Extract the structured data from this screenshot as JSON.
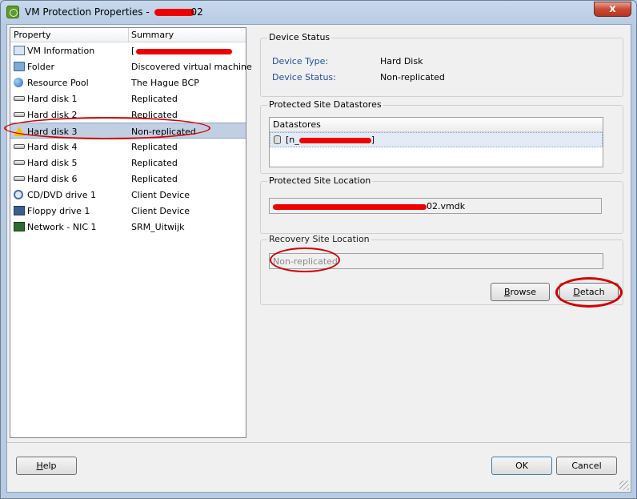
{
  "window": {
    "title_prefix": "VM Protection Properties - ",
    "title_suffix": "02",
    "close_label": "x"
  },
  "list": {
    "col_property": "Property",
    "col_summary": "Summary",
    "rows": [
      {
        "name": "VM Information",
        "summary": "[",
        "icon": "vm-info-icon"
      },
      {
        "name": "Folder",
        "summary": "Discovered virtual machine",
        "icon": "folder-icon"
      },
      {
        "name": "Resource Pool",
        "summary": "The Hague BCP",
        "icon": "resource-pool-icon"
      },
      {
        "name": "Hard disk 1",
        "summary": "Replicated",
        "icon": "hard-disk-icon"
      },
      {
        "name": "Hard disk 2",
        "summary": "Replicated",
        "icon": "hard-disk-icon"
      },
      {
        "name": "Hard disk 3",
        "summary": "Non-replicated",
        "icon": "warning-icon"
      },
      {
        "name": "Hard disk 4",
        "summary": "Replicated",
        "icon": "hard-disk-icon"
      },
      {
        "name": "Hard disk 5",
        "summary": "Replicated",
        "icon": "hard-disk-icon"
      },
      {
        "name": "Hard disk 6",
        "summary": "Replicated",
        "icon": "hard-disk-icon"
      },
      {
        "name": "CD/DVD drive 1",
        "summary": "Client Device",
        "icon": "cd-dvd-icon"
      },
      {
        "name": "Floppy drive 1",
        "summary": "Client Device",
        "icon": "floppy-icon"
      },
      {
        "name": "Network - NIC 1",
        "summary": "SRM_Uitwijk",
        "icon": "network-nic-icon"
      }
    ]
  },
  "device_status": {
    "title": "Device Status",
    "type_label": "Device Type:",
    "type_value": "Hard Disk",
    "status_label": "Device Status:",
    "status_value": "Non-replicated"
  },
  "protected_datastores": {
    "title": "Protected Site Datastores",
    "column": "Datastores",
    "row_prefix": "[n_"
  },
  "protected_location": {
    "title": "Protected Site Location",
    "path_suffix": "02.vmdk"
  },
  "recovery_location": {
    "title": "Recovery Site Location",
    "value": "Non-replicated",
    "browse_label": "rowse",
    "browse_mnemonic": "B",
    "detach_label": "etach",
    "detach_mnemonic": "D"
  },
  "footer": {
    "help_label": "elp",
    "help_mnemonic": "H",
    "ok_label": "OK",
    "cancel_label": "Cancel"
  },
  "highlight_color": "#d40000"
}
